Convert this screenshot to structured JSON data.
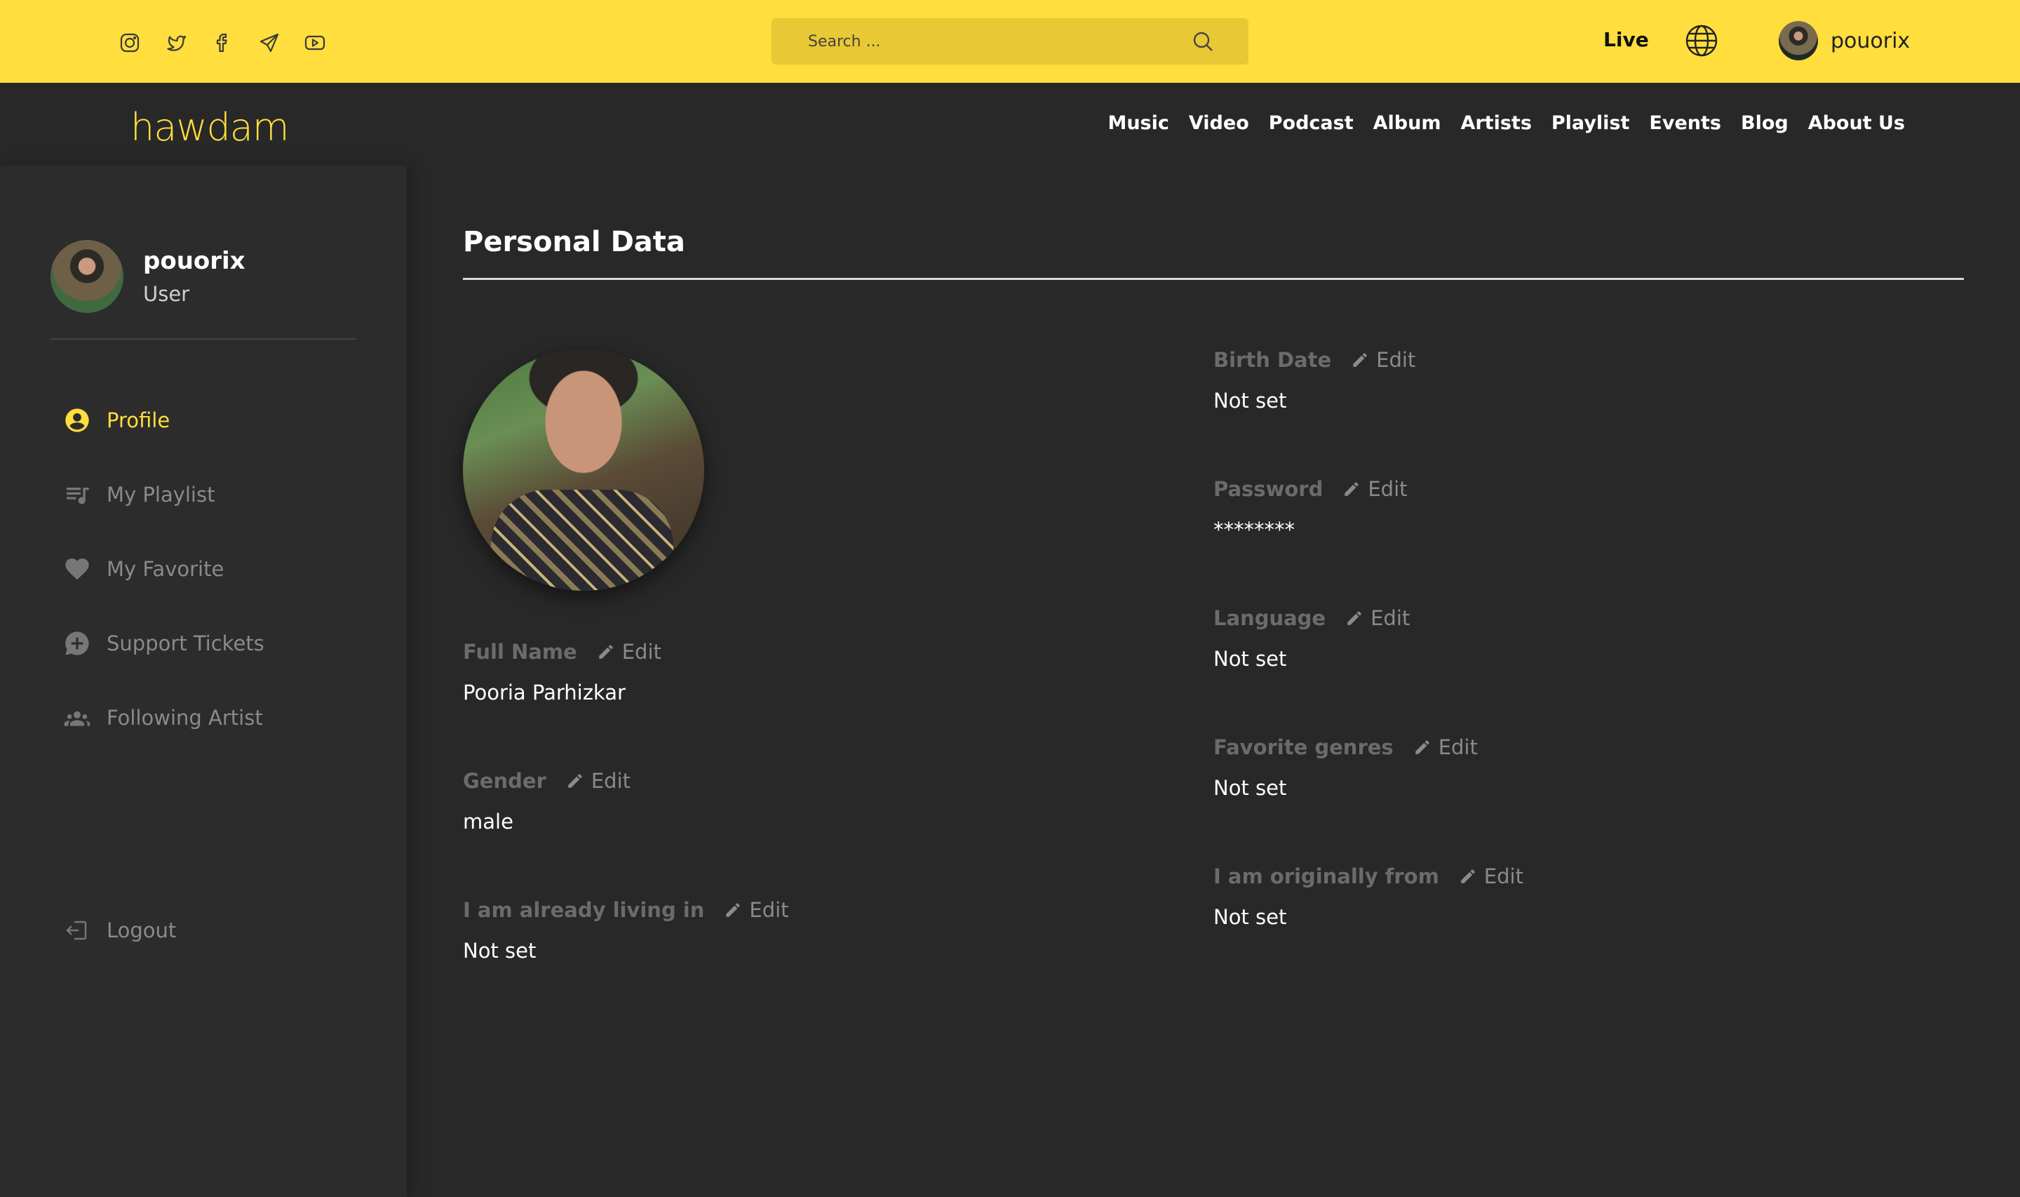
{
  "topbar": {
    "social_icons": [
      "instagram-icon",
      "twitter-icon",
      "facebook-icon",
      "telegram-icon",
      "youtube-icon"
    ],
    "search_placeholder": "Search ...",
    "live_label": "Live",
    "username": "pouorix"
  },
  "navbar": {
    "logo_text": "hawdam",
    "links": [
      "Music",
      "Video",
      "Podcast",
      "Album",
      "Artists",
      "Playlist",
      "Events",
      "Blog",
      "About Us"
    ]
  },
  "sidebar": {
    "username": "pouorix",
    "role": "User",
    "items": [
      {
        "label": "Profile",
        "icon": "profile-icon",
        "active": true
      },
      {
        "label": "My Playlist",
        "icon": "playlist-icon",
        "active": false
      },
      {
        "label": "My Favorite",
        "icon": "heart-icon",
        "active": false
      },
      {
        "label": "Support Tickets",
        "icon": "support-icon",
        "active": false
      },
      {
        "label": "Following Artist",
        "icon": "group-icon",
        "active": false
      }
    ],
    "logout_label": "Logout"
  },
  "main": {
    "title": "Personal Data",
    "edit_label": "Edit",
    "left_fields": [
      {
        "label": "Full Name",
        "value": "Pooria Parhizkar"
      },
      {
        "label": "Gender",
        "value": "male"
      },
      {
        "label": "I am already living in",
        "value": "Not set"
      }
    ],
    "right_fields": [
      {
        "label": "Birth Date",
        "value": "Not set"
      },
      {
        "label": "Password",
        "value": "********"
      },
      {
        "label": "Language",
        "value": "Not set"
      },
      {
        "label": "Favorite genres",
        "value": "Not set"
      },
      {
        "label": "I am originally from",
        "value": "Not set"
      }
    ]
  },
  "colors": {
    "accent": "#ffde3d",
    "background": "#282828",
    "sidebar": "#2c2c2c"
  }
}
